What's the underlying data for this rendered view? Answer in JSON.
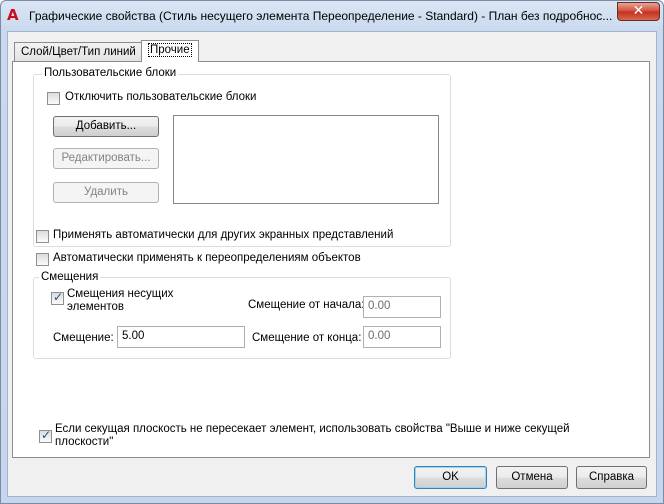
{
  "window": {
    "title": "Графические свойства (Стиль несущего элемента Переопределение - Standard) - План без подробнос...",
    "app_icon_glyph": "A",
    "close_glyph": "✕"
  },
  "tabs": [
    {
      "label": "Слой/Цвет/Тип линий",
      "active": false
    },
    {
      "label": "Прочие",
      "active": true
    }
  ],
  "custom_blocks": {
    "group_title": "Пользовательские блоки",
    "disable_label": "Отключить пользовательские блоки",
    "disable_checked": false,
    "add_button": "Добавить...",
    "edit_button": "Редактировать...",
    "delete_button": "Удалить"
  },
  "options": {
    "apply_auto_other_label": "Применять автоматически для других экранных представлений",
    "apply_auto_other_checked": false,
    "apply_auto_overrides_label": "Автоматически применять к переопределениям объектов",
    "apply_auto_overrides_checked": false
  },
  "offsets": {
    "group_title": "Смещения",
    "member_offsets_label_line1": "Смещения несущих",
    "member_offsets_label_line2": "элементов",
    "member_offsets_checked": true,
    "offset_label": "Смещение:",
    "offset_value": "5.00",
    "start_offset_label": "Смещение от начала:",
    "start_offset_value": "0.00",
    "end_offset_label": "Смещение от конца:",
    "end_offset_value": "0.00"
  },
  "section_plane": {
    "label_line1": "Если секущая плоскость не пересекает элемент, использовать свойства \"Выше и ниже секущей",
    "label_line2": "плоскости\"",
    "checked": true
  },
  "footer": {
    "ok_button": "OK",
    "cancel_button": "Отмена",
    "help_button": "Справка"
  }
}
